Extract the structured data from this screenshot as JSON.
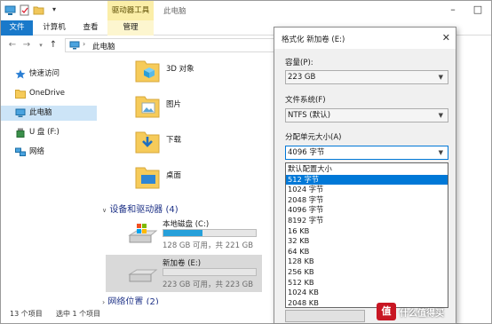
{
  "explorer": {
    "window_title": "此电脑",
    "context_tab_header": "驱动器工具",
    "ribbon_tabs": [
      "文件",
      "计算机",
      "查看",
      "管理"
    ],
    "address": "此电脑",
    "sidebar": [
      {
        "label": "快速访问",
        "icon": "star-icon"
      },
      {
        "label": "OneDrive",
        "icon": "folder-icon"
      },
      {
        "label": "此电脑",
        "icon": "computer-icon",
        "selected": true
      },
      {
        "label": "U 盘 (F:)",
        "icon": "usb-icon"
      },
      {
        "label": "网络",
        "icon": "network-icon"
      }
    ],
    "folders": [
      {
        "label": "3D 对象"
      },
      {
        "label": "图片"
      },
      {
        "label": "下载"
      },
      {
        "label": "桌面"
      }
    ],
    "groups": {
      "devices": "设备和驱动器 (4)",
      "network": "网络位置 (2)"
    },
    "drives": [
      {
        "name": "本地磁盘 (C:)",
        "space": "128 GB 可用，共 221 GB",
        "used_fraction": 0.42,
        "selected": false
      },
      {
        "name": "新加卷 (E:)",
        "space": "223 GB 可用，共 223 GB",
        "used_fraction": 0.0,
        "selected": true
      }
    ],
    "status": {
      "count": "13 个项目",
      "selection": "选中 1 个项目"
    }
  },
  "dialog": {
    "title": "格式化 新加卷 (E:)",
    "capacity_label": "容量(P):",
    "capacity_value": "223 GB",
    "fs_label": "文件系统(F)",
    "fs_value": "NTFS (默认)",
    "alloc_label": "分配单元大小(A)",
    "alloc_value": "4096 字节",
    "alloc_options": [
      "默认配置大小",
      "512 字节",
      "1024 字节",
      "2048 字节",
      "4096 字节",
      "8192 字节",
      "16 KB",
      "32 KB",
      "64 KB",
      "128 KB",
      "256 KB",
      "512 KB",
      "1024 KB",
      "2048 KB"
    ],
    "alloc_highlighted_index": 1
  },
  "watermark": {
    "badge": "值",
    "text": "什么值得买"
  },
  "colors": {
    "accent": "#0078d7",
    "file_tab": "#1979ca",
    "context_tab": "#fbeea8",
    "sidebar_selected": "#cce4f7",
    "drive_fill": "#26a0da"
  }
}
